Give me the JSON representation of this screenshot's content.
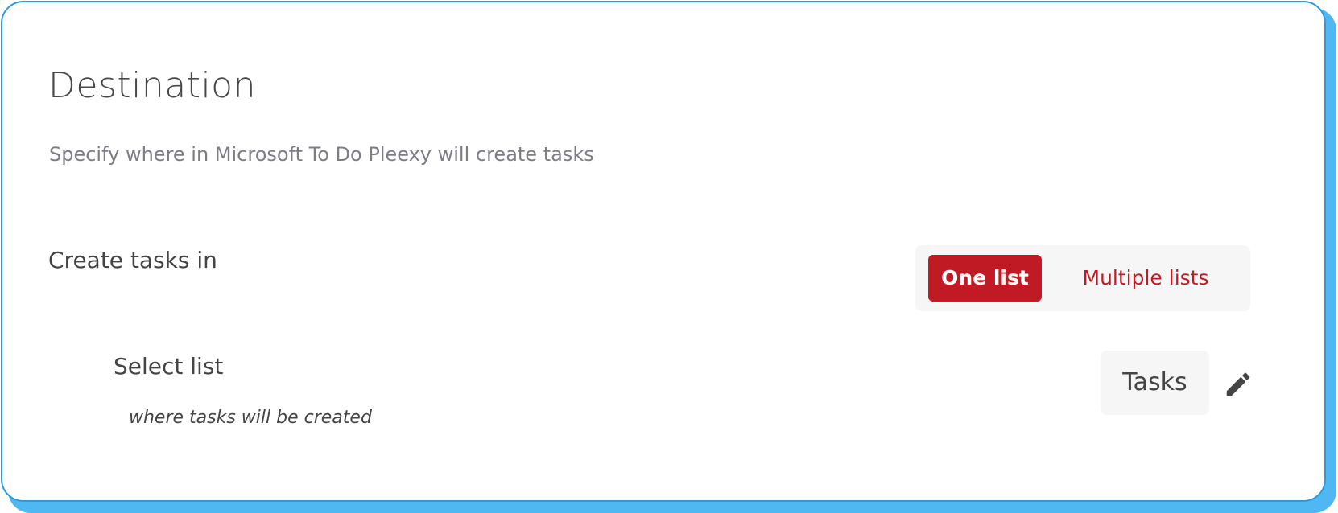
{
  "destination": {
    "title": "Destination",
    "subtitle": "Specify where in Microsoft To Do Pleexy will create tasks"
  },
  "create_tasks": {
    "label": "Create tasks in",
    "options": [
      "One list",
      "Multiple lists"
    ],
    "selected": "One list"
  },
  "select_list": {
    "label": "Select list",
    "hint": "where tasks will be created",
    "value": "Tasks",
    "edit_icon": "pencil-icon"
  },
  "colors": {
    "accent": "#c01a24",
    "border": "#2b9be0",
    "shadow": "#4fb8f2"
  }
}
